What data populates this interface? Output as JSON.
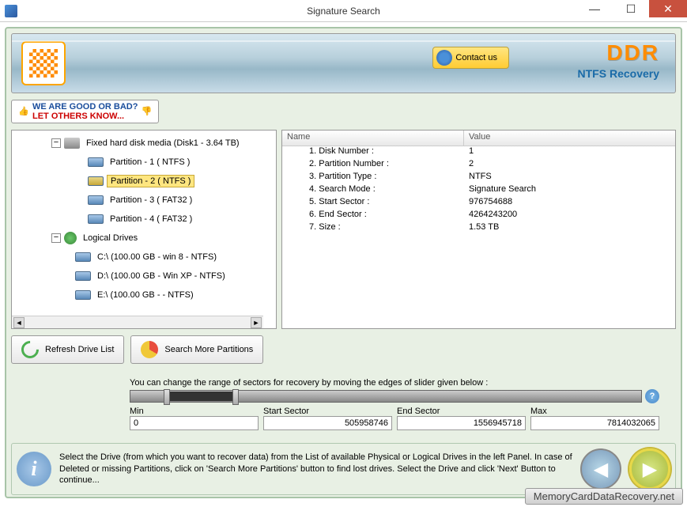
{
  "window": {
    "title": "Signature Search"
  },
  "banner": {
    "contact": "Contact us",
    "brand": "DDR",
    "subtitle": "NTFS Recovery"
  },
  "feedback": {
    "line1": "WE ARE GOOD OR BAD?",
    "line2": "LET OTHERS KNOW..."
  },
  "tree": {
    "disk": "Fixed hard disk media (Disk1 - 3.64 TB)",
    "parts": [
      "Partition - 1 ( NTFS )",
      "Partition - 2 ( NTFS )",
      "Partition - 3 ( FAT32 )",
      "Partition - 4 ( FAT32 )"
    ],
    "logical_header": "Logical Drives",
    "logical": [
      "C:\\ (100.00 GB - win 8 - NTFS)",
      "D:\\ (100.00 GB - Win XP - NTFS)",
      "E:\\ (100.00 GB -  - NTFS)"
    ]
  },
  "props": {
    "headers": {
      "name": "Name",
      "value": "Value"
    },
    "rows": [
      {
        "n": "1. Disk Number :",
        "v": "1"
      },
      {
        "n": "2. Partition Number :",
        "v": "2"
      },
      {
        "n": "3. Partition Type :",
        "v": "NTFS"
      },
      {
        "n": "4. Search Mode :",
        "v": "Signature Search"
      },
      {
        "n": "5. Start Sector :",
        "v": "976754688"
      },
      {
        "n": "6. End Sector :",
        "v": "4264243200"
      },
      {
        "n": "7. Size :",
        "v": "1.53 TB"
      }
    ]
  },
  "buttons": {
    "refresh": "Refresh Drive List",
    "search": "Search More Partitions"
  },
  "slider": {
    "hint": "You can change the range of sectors for recovery by moving the edges of slider given below :",
    "min_label": "Min",
    "min": "0",
    "start_label": "Start Sector",
    "start": "505958746",
    "end_label": "End Sector",
    "end": "1556945718",
    "max_label": "Max",
    "max": "7814032065"
  },
  "footer": {
    "text": "Select the Drive (from which you want to recover data) from the List of available Physical or Logical Drives in the left Panel. In case of Deleted or missing Partitions, click on 'Search More Partitions' button to find lost drives. Select the Drive and click 'Next' Button to continue..."
  },
  "watermark": "MemoryCardDataRecovery.net"
}
